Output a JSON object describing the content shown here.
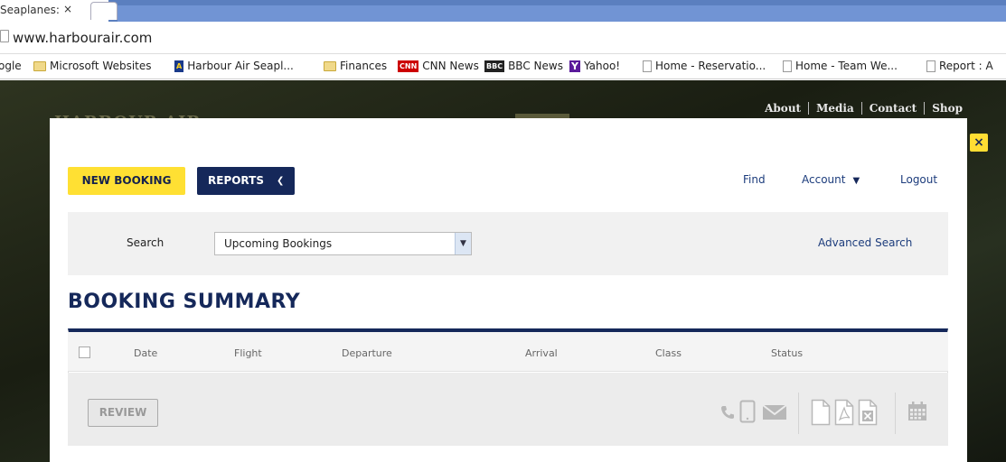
{
  "browser": {
    "tab_title": "Seaplanes:",
    "tab_close": "×",
    "url": "www.harbourair.com",
    "bookmarks": [
      {
        "label": "ogle"
      },
      {
        "label": "Microsoft Websites"
      },
      {
        "label": "Harbour Air Seapl..."
      },
      {
        "label": "Finances"
      },
      {
        "label": "CNN News"
      },
      {
        "label": "BBC News"
      },
      {
        "label": "Yahoo!"
      },
      {
        "label": "Home - Reservatio..."
      },
      {
        "label": "Home - Team We..."
      },
      {
        "label": "Report : A"
      }
    ],
    "badges": {
      "cnn": "CNN",
      "bbc": "BBC",
      "yahoo": "Y"
    }
  },
  "site": {
    "topnav": [
      "About",
      "Media",
      "Contact",
      "Shop"
    ],
    "logo_text": "HARBOUR AIR"
  },
  "modal": {
    "close_label": "×",
    "new_booking_label": "NEW BOOKING",
    "reports_label": "REPORTS",
    "find_label": "Find",
    "account_label": "Account",
    "logout_label": "Logout",
    "search": {
      "label": "Search",
      "selected_value": "Upcoming Bookings",
      "advanced_label": "Advanced Search"
    },
    "summary_title": "BOOKING SUMMARY",
    "table": {
      "columns": [
        "Date",
        "Flight",
        "Departure",
        "Arrival",
        "Class",
        "Status"
      ]
    },
    "review_label": "REVIEW"
  },
  "colors": {
    "navy": "#15285a",
    "yellow": "#ffe033",
    "link": "#1c3c7c"
  }
}
